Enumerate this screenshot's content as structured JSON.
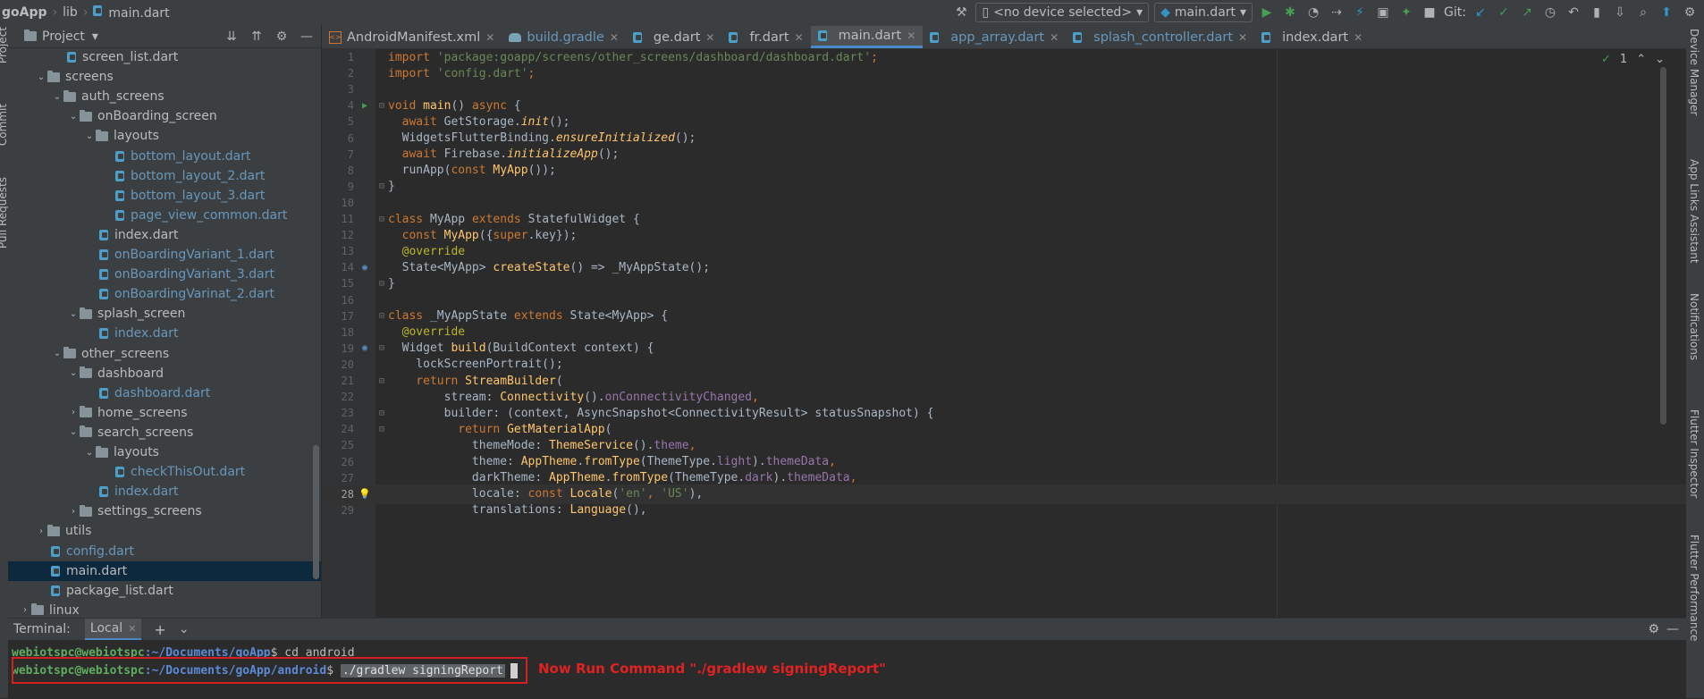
{
  "window": {
    "breadcrumb": [
      "goApp",
      "lib",
      "main.dart"
    ],
    "device_selector": "<no device selected>",
    "run_config": "main.dart",
    "git_label": "Git:"
  },
  "left_strip": {
    "labels": [
      "Project",
      "Commit",
      "Pull Requests"
    ]
  },
  "right_strip": {
    "labels": [
      "Device Manager",
      "App Links Assistant",
      "Notifications",
      "Flutter Inspector",
      "Flutter Performance"
    ]
  },
  "project_panel": {
    "title": "Project",
    "tree": [
      {
        "label": "screen_list.dart",
        "type": "file",
        "depth": 4,
        "color": "normal"
      },
      {
        "label": "screens",
        "type": "folder",
        "depth": 2,
        "expanded": true
      },
      {
        "label": "auth_screens",
        "type": "folder",
        "depth": 3,
        "expanded": true
      },
      {
        "label": "onBoarding_screen",
        "type": "folder",
        "depth": 4,
        "expanded": true
      },
      {
        "label": "layouts",
        "type": "folder",
        "depth": 5,
        "expanded": true
      },
      {
        "label": "bottom_layout.dart",
        "type": "file",
        "depth": 7,
        "color": "blue"
      },
      {
        "label": "bottom_layout_2.dart",
        "type": "file",
        "depth": 7,
        "color": "blue"
      },
      {
        "label": "bottom_layout_3.dart",
        "type": "file",
        "depth": 7,
        "color": "blue"
      },
      {
        "label": "page_view_common.dart",
        "type": "file",
        "depth": 7,
        "color": "blue"
      },
      {
        "label": "index.dart",
        "type": "file",
        "depth": 6,
        "color": "normal"
      },
      {
        "label": "onBoardingVariant_1.dart",
        "type": "file",
        "depth": 6,
        "color": "blue"
      },
      {
        "label": "onBoardingVariant_3.dart",
        "type": "file",
        "depth": 6,
        "color": "blue"
      },
      {
        "label": "onBoardingVarinat_2.dart",
        "type": "file",
        "depth": 6,
        "color": "blue"
      },
      {
        "label": "splash_screen",
        "type": "folder",
        "depth": 4,
        "expanded": true
      },
      {
        "label": "index.dart",
        "type": "file",
        "depth": 6,
        "color": "blue"
      },
      {
        "label": "other_screens",
        "type": "folder",
        "depth": 3,
        "expanded": true
      },
      {
        "label": "dashboard",
        "type": "folder",
        "depth": 4,
        "expanded": true
      },
      {
        "label": "dashboard.dart",
        "type": "file",
        "depth": 6,
        "color": "blue"
      },
      {
        "label": "home_screens",
        "type": "folder",
        "depth": 4,
        "expanded": false
      },
      {
        "label": "search_screens",
        "type": "folder",
        "depth": 4,
        "expanded": true
      },
      {
        "label": "layouts",
        "type": "folder",
        "depth": 5,
        "expanded": true
      },
      {
        "label": "checkThisOut.dart",
        "type": "file",
        "depth": 7,
        "color": "blue"
      },
      {
        "label": "index.dart",
        "type": "file",
        "depth": 6,
        "color": "blue"
      },
      {
        "label": "settings_screens",
        "type": "folder",
        "depth": 4,
        "expanded": false
      },
      {
        "label": "utils",
        "type": "folder",
        "depth": 2,
        "expanded": false
      },
      {
        "label": "config.dart",
        "type": "file",
        "depth": 3,
        "color": "blue"
      },
      {
        "label": "main.dart",
        "type": "file",
        "depth": 3,
        "color": "normal",
        "selected": true
      },
      {
        "label": "package_list.dart",
        "type": "file",
        "depth": 3,
        "color": "normal"
      },
      {
        "label": "linux",
        "type": "folder",
        "depth": 1,
        "expanded": false
      }
    ]
  },
  "editor": {
    "tabs": [
      {
        "label": "AndroidManifest.xml",
        "icon": "xml-file-icon"
      },
      {
        "label": "build.gradle",
        "icon": "gradle-icon",
        "blue": true
      },
      {
        "label": "ge.dart",
        "icon": "dart-file-icon"
      },
      {
        "label": "fr.dart",
        "icon": "dart-file-icon"
      },
      {
        "label": "main.dart",
        "icon": "dart-file-icon",
        "active": true
      },
      {
        "label": "app_array.dart",
        "icon": "dart-file-icon",
        "blue": true
      },
      {
        "label": "splash_controller.dart",
        "icon": "dart-file-icon",
        "blue": true
      },
      {
        "label": "index.dart",
        "icon": "dart-file-icon"
      }
    ],
    "inspection_count": "1",
    "current_line": 28,
    "lines": [
      [
        [
          "k",
          "import "
        ],
        [
          "s",
          "'package:goapp/screens/other_screens/dashboard/dashboard.dart'"
        ],
        [
          "k",
          ";"
        ]
      ],
      [
        [
          "k",
          "import "
        ],
        [
          "s",
          "'config.dart'"
        ],
        [
          "k",
          ";"
        ]
      ],
      [],
      [
        [
          "k",
          "void "
        ],
        [
          "f",
          "main"
        ],
        [
          "c",
          "() "
        ],
        [
          "k",
          "async "
        ],
        [
          "c",
          "{"
        ]
      ],
      [
        [
          "k",
          "  await "
        ],
        [
          "c",
          "GetStorage."
        ],
        [
          "i",
          "init"
        ],
        [
          "c",
          "();"
        ]
      ],
      [
        [
          "c",
          "  WidgetsFlutterBinding."
        ],
        [
          "i",
          "ensureInitialized"
        ],
        [
          "c",
          "();"
        ]
      ],
      [
        [
          "k",
          "  await "
        ],
        [
          "c",
          "Firebase."
        ],
        [
          "i",
          "initializeApp"
        ],
        [
          "c",
          "();"
        ]
      ],
      [
        [
          "c",
          "  runApp("
        ],
        [
          "k",
          "const "
        ],
        [
          "f",
          "MyApp"
        ],
        [
          "c",
          "());"
        ]
      ],
      [
        [
          "c",
          "}"
        ]
      ],
      [],
      [
        [
          "k",
          "class "
        ],
        [
          "c",
          "MyApp "
        ],
        [
          "k",
          "extends "
        ],
        [
          "c",
          "StatefulWidget {"
        ]
      ],
      [
        [
          "k",
          "  const "
        ],
        [
          "f",
          "MyApp"
        ],
        [
          "c",
          "({"
        ],
        [
          "k",
          "super"
        ],
        [
          "c",
          ".key});"
        ]
      ],
      [
        [
          "ann",
          "  @override"
        ]
      ],
      [
        [
          "c",
          "  State<MyApp> "
        ],
        [
          "f",
          "createState"
        ],
        [
          "c",
          "() => _MyAppState();"
        ]
      ],
      [
        [
          "c",
          "}"
        ]
      ],
      [],
      [
        [
          "k",
          "class "
        ],
        [
          "c",
          "_MyAppState "
        ],
        [
          "k",
          "extends "
        ],
        [
          "c",
          "State<MyApp> {"
        ]
      ],
      [
        [
          "ann",
          "  @override"
        ]
      ],
      [
        [
          "c",
          "  Widget "
        ],
        [
          "f",
          "build"
        ],
        [
          "c",
          "(BuildContext context) {"
        ]
      ],
      [
        [
          "c",
          "    lockScreenPortrait();"
        ]
      ],
      [
        [
          "k",
          "    return "
        ],
        [
          "f",
          "StreamBuilder"
        ],
        [
          "c",
          "("
        ]
      ],
      [
        [
          "c",
          "        stream: "
        ],
        [
          "f",
          "Connectivity"
        ],
        [
          "c",
          "()."
        ],
        [
          "prop",
          "onConnectivityChanged"
        ],
        [
          "k",
          ","
        ]
      ],
      [
        [
          "c",
          "        builder: (context, AsyncSnapshot<ConnectivityResult> statusSnapshot) {"
        ]
      ],
      [
        [
          "k",
          "          return "
        ],
        [
          "f",
          "GetMaterialApp"
        ],
        [
          "c",
          "("
        ]
      ],
      [
        [
          "c",
          "            themeMode: "
        ],
        [
          "f",
          "ThemeService"
        ],
        [
          "c",
          "()."
        ],
        [
          "prop",
          "theme"
        ],
        [
          "k",
          ","
        ]
      ],
      [
        [
          "c",
          "            theme: "
        ],
        [
          "f",
          "AppTheme"
        ],
        [
          "c",
          "."
        ],
        [
          "f",
          "fromType"
        ],
        [
          "c",
          "(ThemeType."
        ],
        [
          "prop",
          "light"
        ],
        [
          "c",
          ")."
        ],
        [
          "prop",
          "themeData"
        ],
        [
          "k",
          ","
        ]
      ],
      [
        [
          "c",
          "            darkTheme: "
        ],
        [
          "f",
          "AppTheme"
        ],
        [
          "c",
          "."
        ],
        [
          "f",
          "fromType"
        ],
        [
          "c",
          "(ThemeType."
        ],
        [
          "prop",
          "dark"
        ],
        [
          "c",
          ")."
        ],
        [
          "prop",
          "themeData"
        ],
        [
          "k",
          ","
        ]
      ],
      [
        [
          "c",
          "            locale: "
        ],
        [
          "k",
          "const "
        ],
        [
          "f",
          "Locale"
        ],
        [
          "c",
          "("
        ],
        [
          "s",
          "'en'"
        ],
        [
          "k",
          ", "
        ],
        [
          "s",
          "'US'"
        ],
        [
          "c",
          "),"
        ]
      ],
      [
        [
          "c",
          "            translations: "
        ],
        [
          "f",
          "Language"
        ],
        [
          "c",
          "(),"
        ]
      ]
    ]
  },
  "terminal": {
    "title": "Terminal:",
    "tab": "Local",
    "lines": [
      {
        "user": "webiotspc@webiotspc",
        "path": ":~/Documents/goApp",
        "prompt": "$ ",
        "cmd": "cd android"
      },
      {
        "user": "webiotspc@webiotspc",
        "path": ":~/Documents/goApp/android",
        "prompt": "$ ",
        "cmd": "./gradlew signingReport"
      }
    ],
    "annotation": "Now Run Command \"./gradlew signingReport\""
  }
}
